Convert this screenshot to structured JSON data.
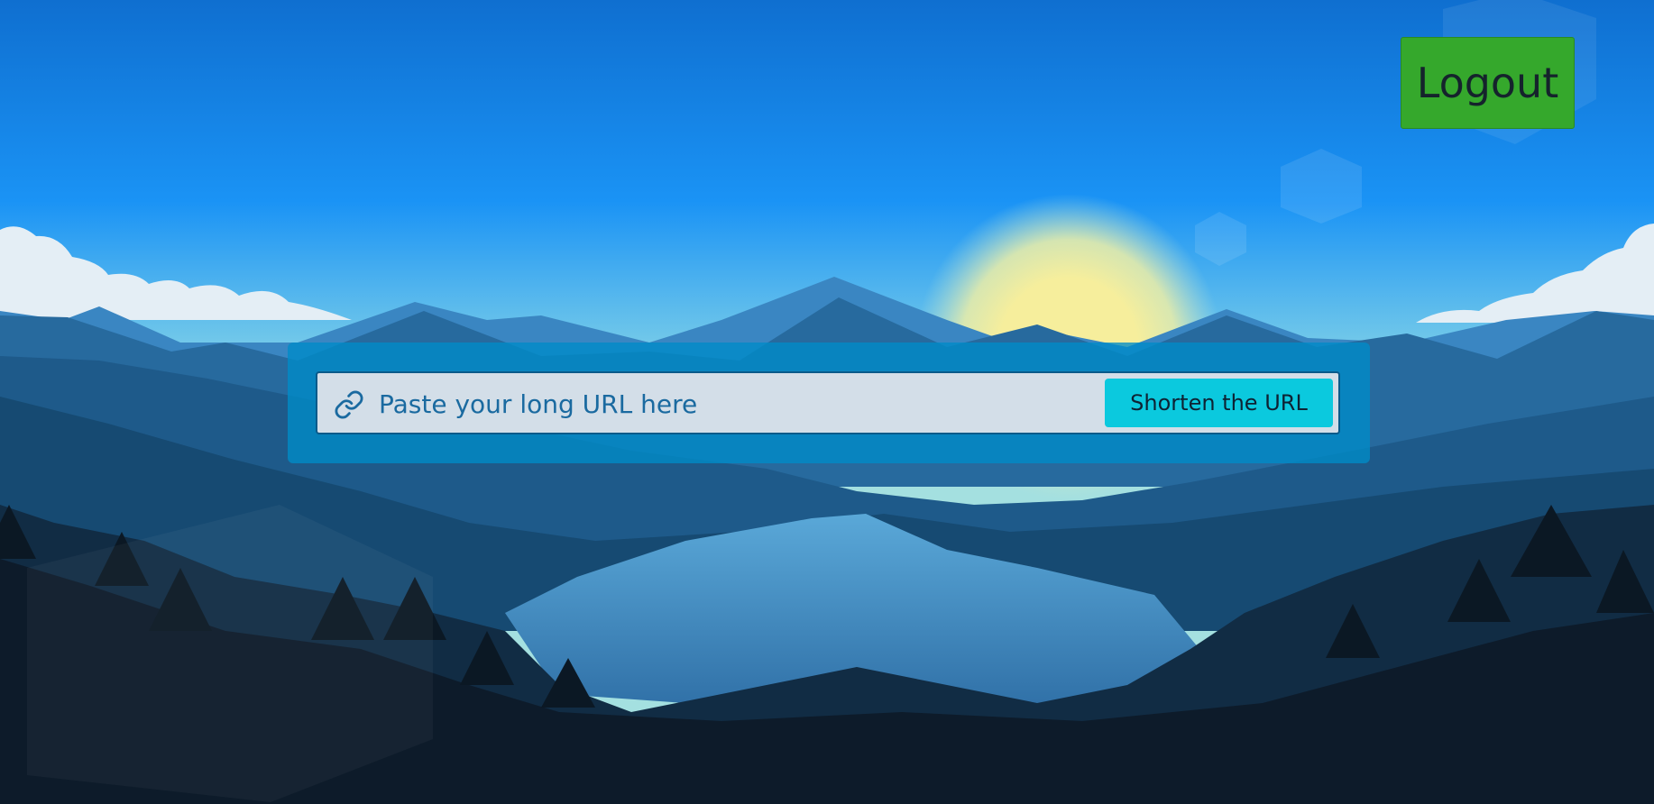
{
  "header": {
    "logout_label": "Logout"
  },
  "shortener": {
    "placeholder": "Paste your long URL here",
    "submit_label": "Shorten the URL",
    "icon": "link-icon"
  },
  "colors": {
    "logout_bg": "#35a82c",
    "submit_bg": "#0bc9de",
    "panel_bg": "#0090c8",
    "input_text": "#1a6aa0"
  },
  "background": {
    "description_icon": "mountain-lake-landscape"
  }
}
